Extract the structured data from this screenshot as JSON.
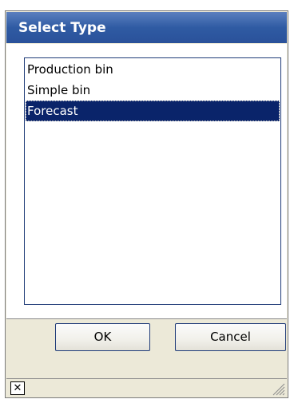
{
  "dialog": {
    "title": "Select Type",
    "list_items": [
      {
        "label": "Production bin",
        "selected": false
      },
      {
        "label": "Simple bin",
        "selected": false
      },
      {
        "label": "Forecast",
        "selected": true
      }
    ],
    "ok_label": "OK",
    "cancel_label": "Cancel",
    "close_glyph": "✕"
  },
  "icons": {
    "close": "close-icon",
    "resize": "resize-grip-icon"
  },
  "colors": {
    "title_bar": "#2f5ba3",
    "selection": "#0a246a",
    "border": "#1f3b78",
    "chrome": "#ece9d8"
  }
}
